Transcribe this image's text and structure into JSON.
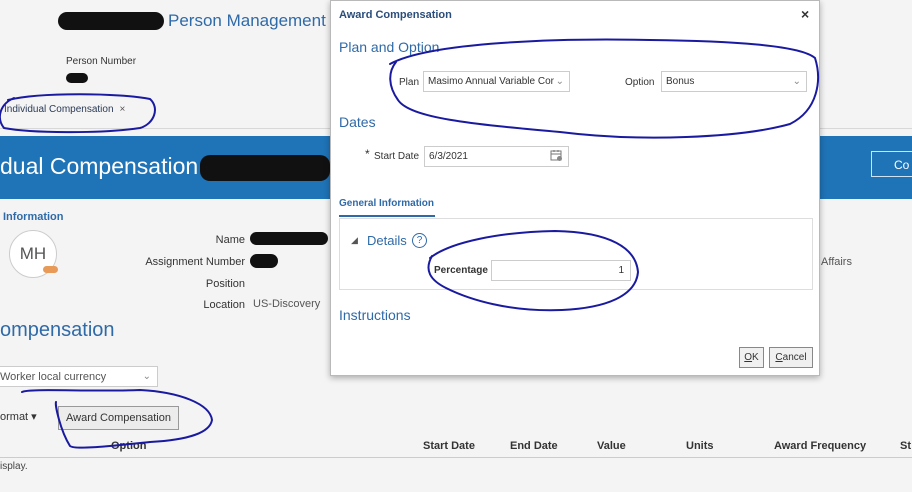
{
  "background": {
    "app_title": "Person Management",
    "person_number_label": "Person Number",
    "tab": {
      "label": "Individual Compensation",
      "close": "×"
    },
    "band_title": "dual Compensation :",
    "band_button": "Co",
    "info_heading": "Information",
    "avatar_initials": "MH",
    "fields": {
      "name_label": "Name",
      "assignment_number_label": "Assignment Number",
      "position_label": "Position",
      "location_label": "Location",
      "location_value": "US-Discovery"
    },
    "affairs_text": "Affairs",
    "compensation_heading": "ompensation",
    "currency_select": "Worker local currency",
    "format_label": "ormat ▾",
    "award_button": "Award Compensation",
    "table_headers": [
      "Option",
      "Start Date",
      "End Date",
      "Value",
      "Units",
      "Award Frequency",
      "St"
    ],
    "no_data_text": "isplay."
  },
  "dialog": {
    "title": "Award Compensation",
    "close": "×",
    "plan_option_heading": "Plan and Option",
    "plan_label": "Plan",
    "plan_value": "Masimo Annual Variable Cor",
    "option_label": "Option",
    "option_value": "Bonus",
    "dates_heading": "Dates",
    "required_marker": "*",
    "start_date_label": "Start Date",
    "start_date_value": "6/3/2021",
    "subtab_general": "General Information",
    "details_heading": "Details",
    "details_toggle": "◢",
    "help_glyph": "?",
    "percentage_label": "Percentage",
    "percentage_value": "1",
    "instructions_heading": "Instructions",
    "ok_accel": "O",
    "ok_rest": "K",
    "cancel_accel": "C",
    "cancel_rest": "ancel"
  },
  "colors": {
    "accent_blue": "#2f6aa8",
    "band_blue": "#1f73b7",
    "ink_annotation": "#1a1aa0"
  },
  "icons": {
    "calendar": "calendar-icon",
    "help": "help-icon",
    "chevron": "chevron-down-icon",
    "close": "close-icon"
  }
}
